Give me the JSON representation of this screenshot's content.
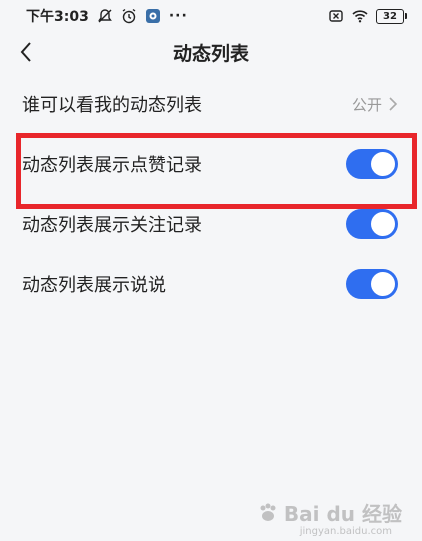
{
  "status_bar": {
    "time": "下午3:03",
    "dots": "···",
    "battery": "32"
  },
  "nav": {
    "title": "动态列表"
  },
  "settings": [
    {
      "label": "谁可以看我的动态列表",
      "value": "公开",
      "type": "link"
    },
    {
      "label": "动态列表展示点赞记录",
      "type": "toggle",
      "on": true
    },
    {
      "label": "动态列表展示关注记录",
      "type": "toggle",
      "on": true
    },
    {
      "label": "动态列表展示说说",
      "type": "toggle",
      "on": true
    }
  ],
  "colors": {
    "toggle_on": "#2f6ef0",
    "highlight": "#e8262b",
    "background": "#f5f6f8"
  },
  "watermark": {
    "text": "Bai du 经验",
    "sub": "jingyan.baidu.com"
  }
}
